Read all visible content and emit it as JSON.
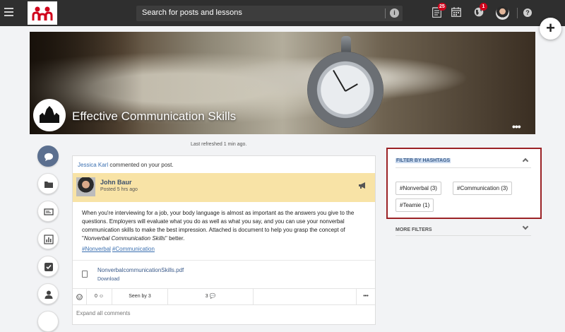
{
  "topbar": {
    "search_placeholder": "Search for posts and lessons",
    "notifications_badge": "25",
    "globe_badge": "1"
  },
  "group": {
    "title": "Effective Communication Skills",
    "more_label": "•••"
  },
  "feed": {
    "last_refreshed": "Last refreshed 1 min ago."
  },
  "post": {
    "notice_user": "Jessica Karl",
    "notice_text": " commented on your post.",
    "author": "John Baur",
    "posted": "Posted 5 hrs ago",
    "body_before": "When you're interviewing for a job, your body language is almost as important as the answers you give to the questions. Employers will evaluate what you do as well as what you say, and you can use your nonverbal communication skills to make the best impression. Attached is document to help you grasp the concept of \"",
    "body_italic": "Nonverbal Communication Skills",
    "body_after": "\" better.",
    "tags": [
      "#Nonverbal",
      "#Communication"
    ],
    "attachment_name": "NonverbalcommunicationSkills.pdf",
    "attachment_download": "Download",
    "reactions": "0",
    "seen_by": "Seen by 3",
    "comments": "3",
    "more": "•••",
    "expand_comments": "Expand all comments"
  },
  "filters": {
    "title": "FILTER BY HASHTAGS",
    "hashtags": [
      "#Nonverbal (3)",
      "#Communication (3)",
      "#Teamie (1)"
    ],
    "more_filters": "MORE FILTERS"
  },
  "colors": {
    "topbar": "#2f2f2f",
    "accent_blue": "#3a6fb0",
    "author_bar": "#f8e3a6",
    "highlight_border": "#9b2226",
    "badge_red": "#d0021b"
  }
}
